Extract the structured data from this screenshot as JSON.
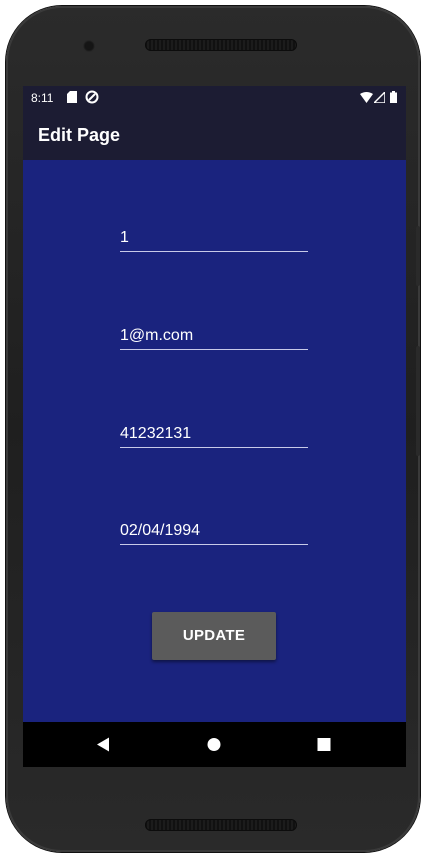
{
  "status_bar": {
    "time": "8:11",
    "icons": [
      "sd-card-icon",
      "sync-icon",
      "wifi-icon",
      "cellular-signal-icon",
      "battery-icon"
    ]
  },
  "app_bar": {
    "title": "Edit Page"
  },
  "form": {
    "fields": [
      {
        "value": "1"
      },
      {
        "value": "1@m.com"
      },
      {
        "value": "41232131"
      },
      {
        "value": "02/04/1994"
      }
    ],
    "update_label": "UPDATE"
  },
  "nav_bar": {
    "icons": [
      "back-icon",
      "home-icon",
      "recents-icon"
    ]
  },
  "colors": {
    "screen_background": "#1a237e",
    "app_bar_background": "#1c1c33",
    "button_background": "#5b5b5b",
    "nav_bar_background": "#000000"
  }
}
